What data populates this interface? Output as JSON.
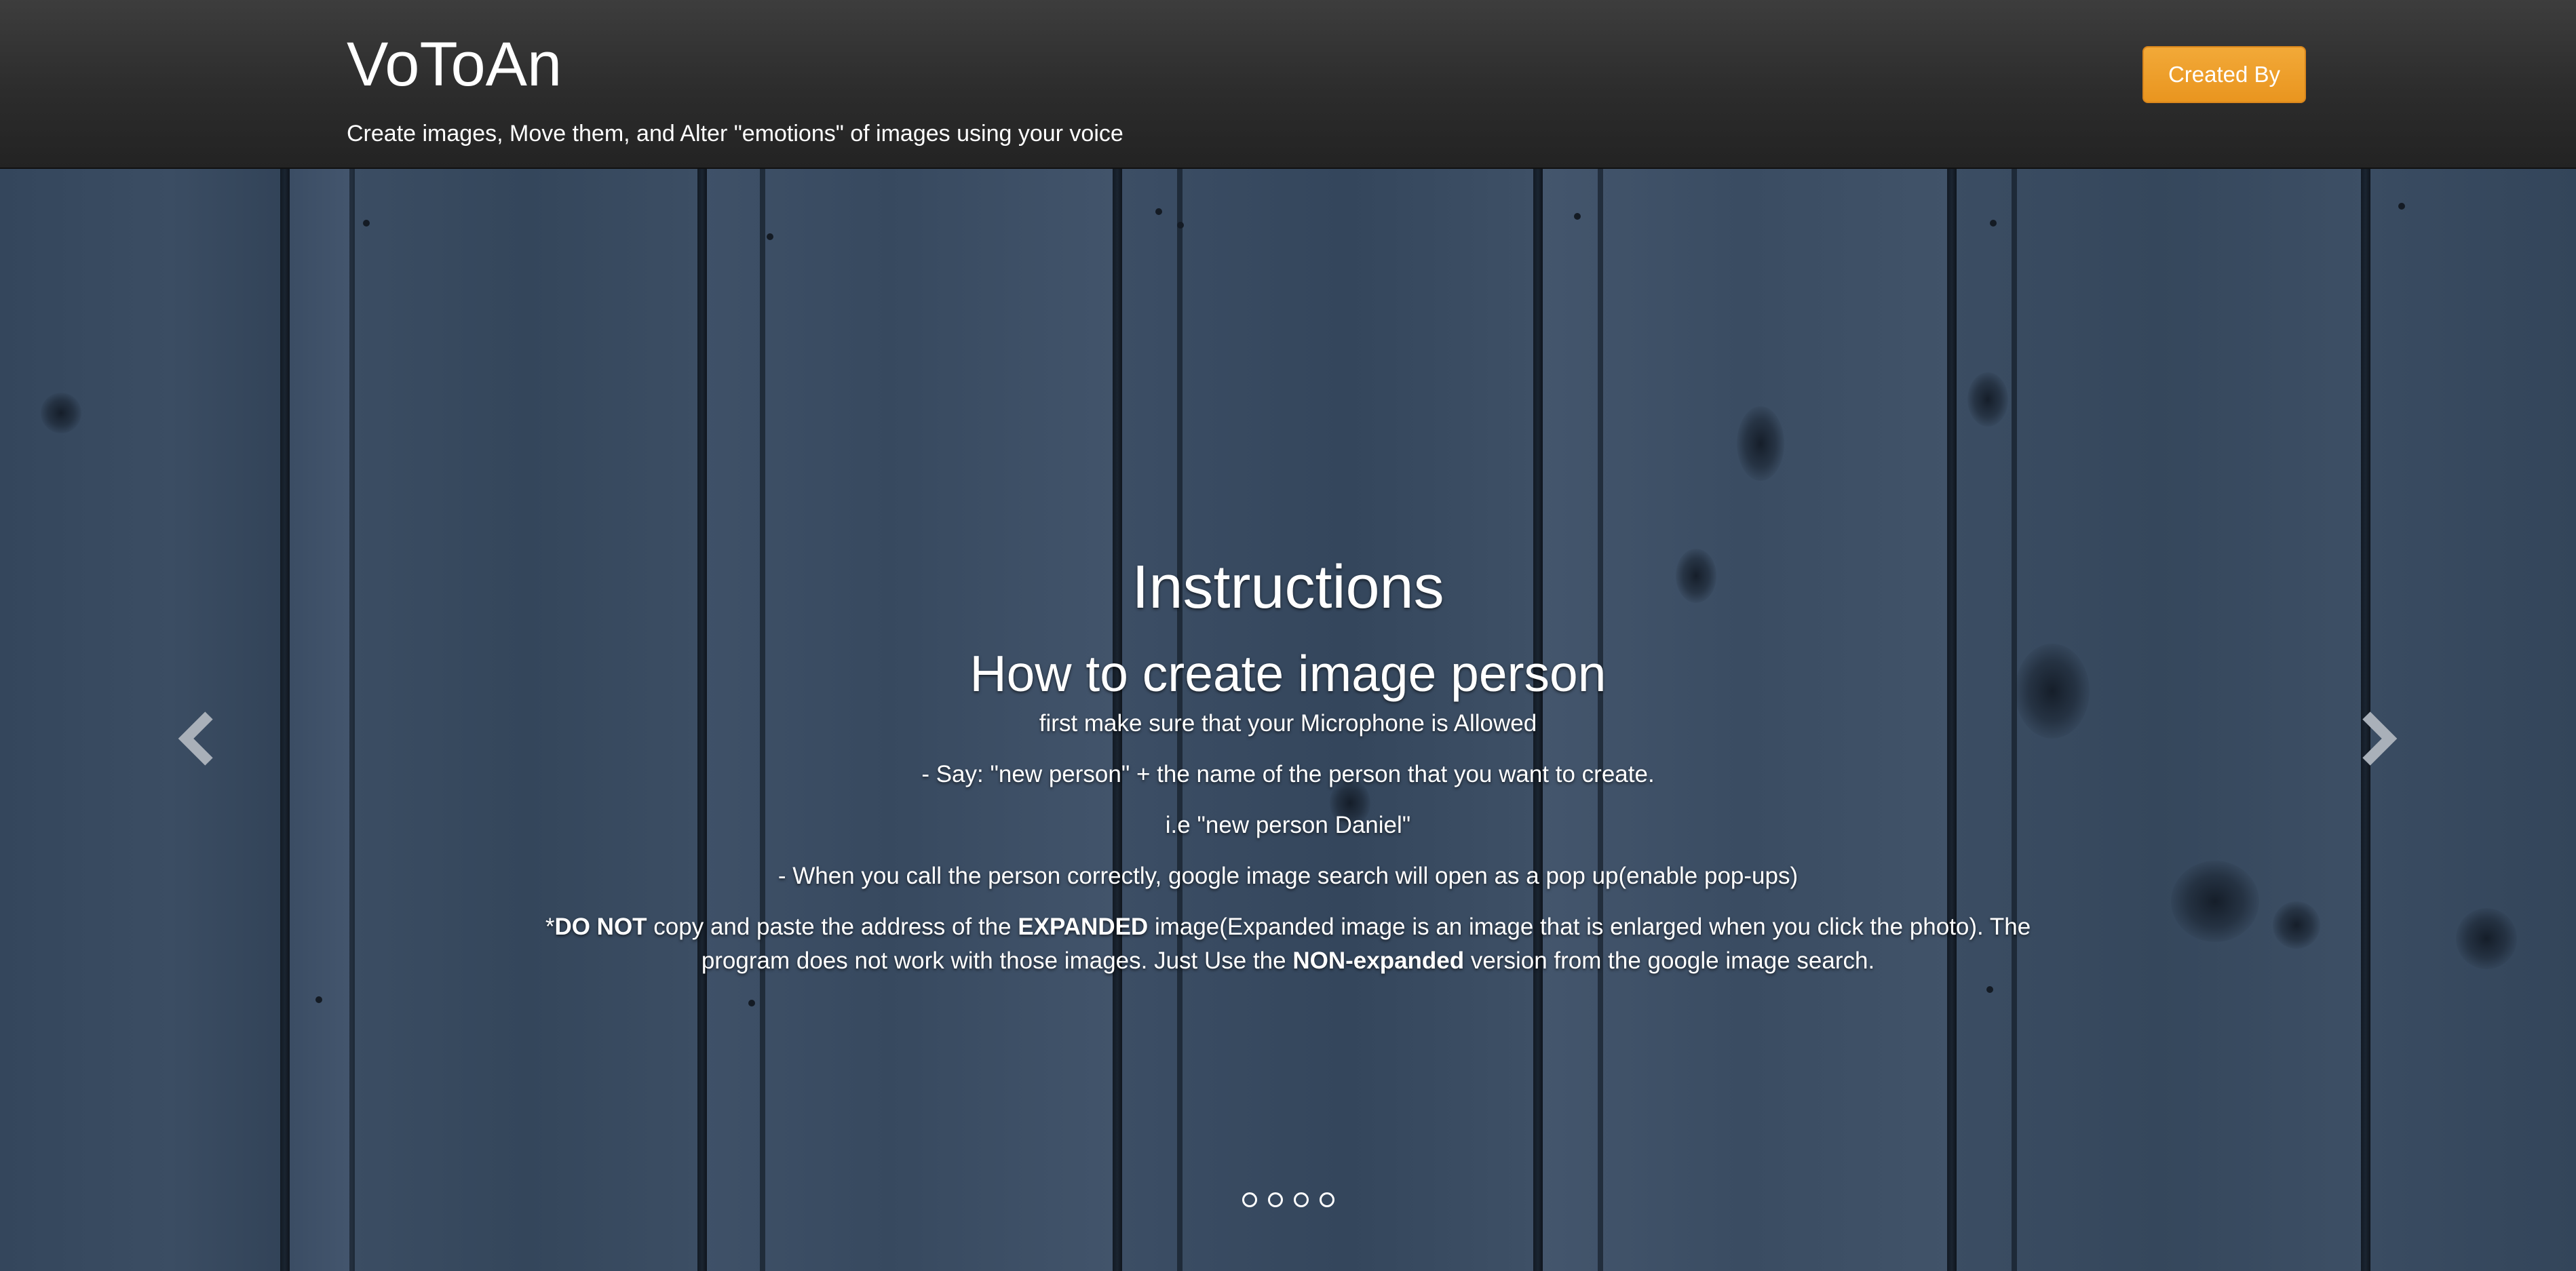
{
  "header": {
    "title": "VoToAn",
    "tagline": "Create images, Move them, and Alter \"emotions\" of images using your voice",
    "created_by_label": "Created By"
  },
  "colors": {
    "header_bg": "#2c2c2c",
    "button_accent": "#f0a030",
    "wood_blue": "#34455b"
  },
  "carousel": {
    "prev_icon": "chevron-left-icon",
    "next_icon": "chevron-right-icon",
    "slide": {
      "title": "Instructions",
      "subtitle": "How to create image person",
      "lines": [
        "first make sure that your Microphone is Allowed",
        "- Say: \"new person\" + the name of the person that you want to create.",
        "i.e \"new person Daniel\"",
        "- When you call the person correctly, google image search will open as a pop up(enable pop-ups)"
      ],
      "warning": {
        "p1_prefix": "*",
        "p1_bold": "DO NOT",
        "p2": " copy and paste the address of the ",
        "p3_bold": "EXPANDED",
        "p4": " image(Expanded image is an image that is enlarged when you click the photo). The program does not work with those images. Just Use the ",
        "p5_bold": "NON-expanded",
        "p6": " version from the google image search."
      }
    },
    "indicator_count": 4
  }
}
